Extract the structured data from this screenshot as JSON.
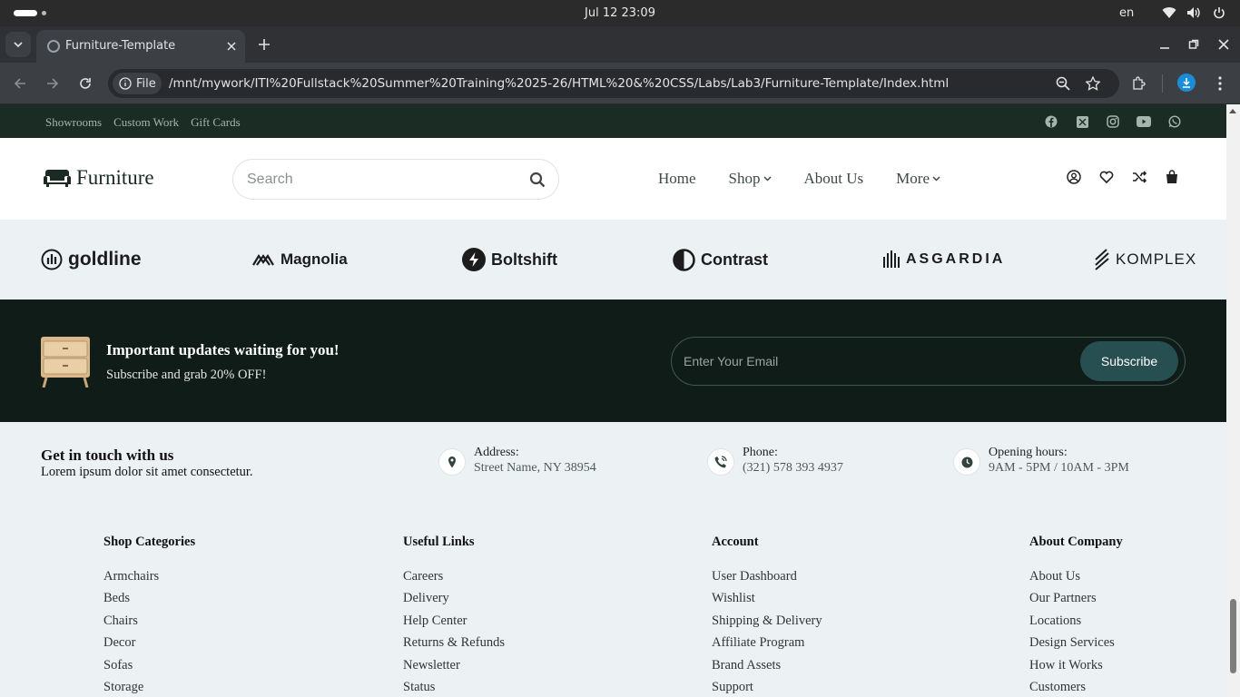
{
  "os": {
    "clock": "Jul 12  23:09",
    "lang": "en"
  },
  "browser": {
    "tab_title": "Furniture-Template",
    "chip_label": "File",
    "url": "/mnt/mywork/ITI%20Fullstack%20Summer%20Training%2025-26/HTML%20&%20CSS/Labs/Lab3/Furniture-Template/Index.html"
  },
  "topbar": {
    "links": [
      "Showrooms",
      "Custom Work",
      "Gift Cards"
    ]
  },
  "header": {
    "logo_text": "Furniture",
    "search_placeholder": "Search",
    "nav": [
      {
        "label": "Home",
        "dropdown": false
      },
      {
        "label": "Shop",
        "dropdown": true
      },
      {
        "label": "About Us",
        "dropdown": false
      },
      {
        "label": "More",
        "dropdown": true
      }
    ]
  },
  "brands": [
    "goldline",
    "Magnolia",
    "Boltshift",
    "Contrast",
    "ASGARDIA",
    "KOMPLEX"
  ],
  "newsletter": {
    "title": "Important updates waiting for you!",
    "subtitle": "Subscribe and grab 20% OFF!",
    "placeholder": "Enter Your Email",
    "button": "Subscribe"
  },
  "contact": {
    "title": "Get in touch with us",
    "subtitle": "Lorem ipsum dolor sit amet consectetur.",
    "items": [
      {
        "label": "Address:",
        "value": "Street Name, NY 38954",
        "icon": "location-pin-icon"
      },
      {
        "label": "Phone:",
        "value": "(321) 578 393 4937",
        "icon": "phone-icon"
      },
      {
        "label": "Opening hours:",
        "value": "9AM - 5PM / 10AM - 3PM",
        "icon": "clock-icon"
      }
    ]
  },
  "footer_columns": [
    {
      "title": "Shop Categories",
      "items": [
        "Armchairs",
        "Beds",
        "Chairs",
        "Decor",
        "Sofas",
        "Storage"
      ]
    },
    {
      "title": "Useful Links",
      "items": [
        "Careers",
        "Delivery",
        "Help Center",
        "Returns & Refunds",
        "Newsletter",
        "Status"
      ]
    },
    {
      "title": "Account",
      "items": [
        "User Dashboard",
        "Wishlist",
        "Shipping & Delivery",
        "Affiliate Program",
        "Brand Assets",
        "Support"
      ]
    },
    {
      "title": "About Company",
      "items": [
        "About Us",
        "Our Partners",
        "Locations",
        "Design Services",
        "How it Works",
        "Customers"
      ]
    }
  ],
  "colors": {
    "dark_green": "#0f1c17",
    "topbar": "#1a2c24",
    "accent": "#274f51",
    "page_bg": "#ecf2f4"
  }
}
